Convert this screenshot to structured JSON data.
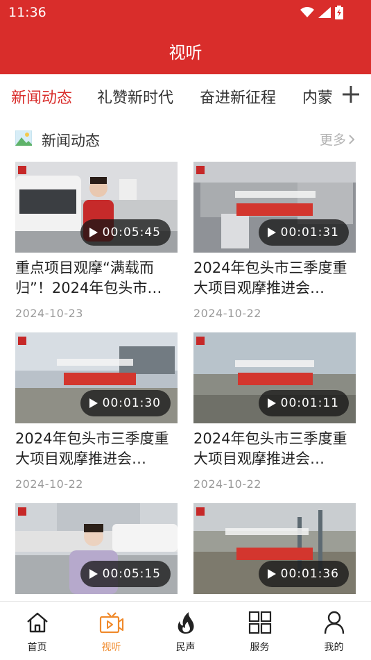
{
  "status_bar": {
    "time": "11:36"
  },
  "header": {
    "title": "视听"
  },
  "tabs": [
    {
      "label": "新闻动态",
      "active": true
    },
    {
      "label": "礼赞新时代",
      "active": false
    },
    {
      "label": "奋进新征程",
      "active": false
    },
    {
      "label": "内蒙",
      "active": false
    }
  ],
  "section": {
    "title": "新闻动态",
    "more": "更多"
  },
  "videos": [
    {
      "title": "重点项目观摩“满载而归”！2024年包头市…",
      "date": "2024-10-23",
      "duration": "00:05:45"
    },
    {
      "title": "2024年包头市三季度重大项目观摩推进会…",
      "date": "2024-10-22",
      "duration": "00:01:31"
    },
    {
      "title": "2024年包头市三季度重大项目观摩推进会…",
      "date": "2024-10-22",
      "duration": "00:01:30"
    },
    {
      "title": "2024年包头市三季度重大项目观摩推进会…",
      "date": "2024-10-22",
      "duration": "00:01:11"
    },
    {
      "title": "",
      "date": "",
      "duration": "00:05:15"
    },
    {
      "title": "",
      "date": "",
      "duration": "00:01:36"
    }
  ],
  "bottom_nav": [
    {
      "label": "首页",
      "icon": "home-icon",
      "active": false
    },
    {
      "label": "视听",
      "icon": "video-tv-icon",
      "active": true
    },
    {
      "label": "民声",
      "icon": "flame-icon",
      "active": false
    },
    {
      "label": "服务",
      "icon": "grid-icon",
      "active": false
    },
    {
      "label": "我的",
      "icon": "user-icon",
      "active": false
    }
  ],
  "colors": {
    "brand_red": "#d92d2b",
    "active_nav": "#f08a2b",
    "muted": "#9a9a9a"
  }
}
